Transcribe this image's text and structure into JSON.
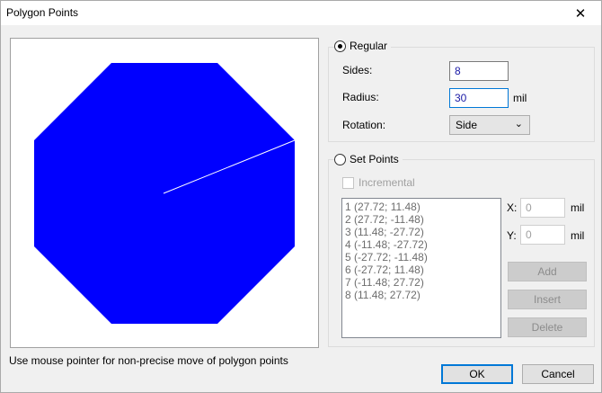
{
  "window": {
    "title": "Polygon Points",
    "close_glyph": "✕"
  },
  "preview": {
    "fill_color": "#0000ff",
    "line_color": "#ffffff"
  },
  "hint": "Use mouse pointer for non-precise move of polygon points",
  "regular": {
    "label": "Regular",
    "checked": true,
    "sides_label": "Sides:",
    "sides_value": "8",
    "radius_label": "Radius:",
    "radius_value": "30",
    "radius_unit": "mil",
    "rotation_label": "Rotation:",
    "rotation_value": "Side"
  },
  "set_points": {
    "label": "Set Points",
    "checked": false,
    "incremental_label": "Incremental",
    "points": [
      "1 (27.72; 11.48)",
      "2 (27.72; -11.48)",
      "3 (11.48; -27.72)",
      "4 (-11.48; -27.72)",
      "5 (-27.72; -11.48)",
      "6 (-27.72; 11.48)",
      "7 (-11.48; 27.72)",
      "8 (11.48; 27.72)"
    ],
    "x_label": "X:",
    "x_value": "0",
    "x_unit": "mil",
    "y_label": "Y:",
    "y_value": "0",
    "y_unit": "mil",
    "add_label": "Add",
    "insert_label": "Insert",
    "delete_label": "Delete"
  },
  "buttons": {
    "ok_label": "OK",
    "cancel_label": "Cancel"
  }
}
